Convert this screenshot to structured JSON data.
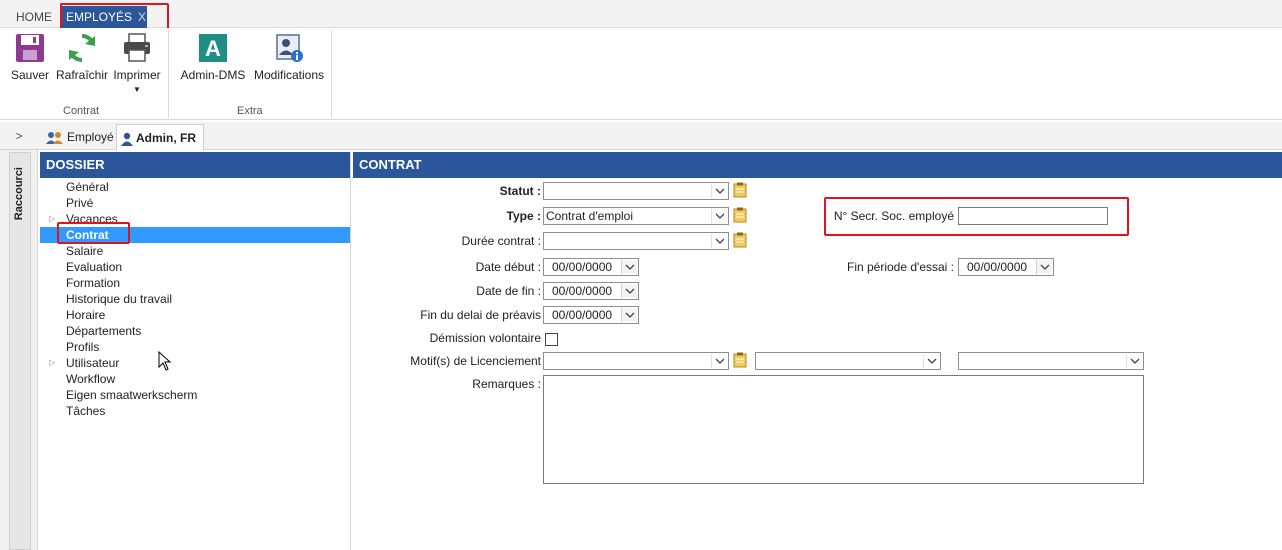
{
  "tabs": {
    "home": "HOME",
    "employes": "EMPLOYÉS",
    "close": "X"
  },
  "ribbon": {
    "save": "Sauver",
    "refresh": "Rafraîchir",
    "print": "Imprimer",
    "admin_dms": "Admin-DMS",
    "modifications": "Modifications",
    "group_contrat": "Contrat",
    "group_extra": "Extra"
  },
  "subtabs": {
    "collapse": ">",
    "employe": "Employé",
    "admin": "Admin, FR"
  },
  "rail": {
    "label": "Raccourci"
  },
  "dossier": {
    "title": "DOSSIER",
    "items": [
      {
        "label": "Général"
      },
      {
        "label": "Privé"
      },
      {
        "label": "Vacances"
      },
      {
        "label": "Contrat"
      },
      {
        "label": "Salaire"
      },
      {
        "label": "Evaluation"
      },
      {
        "label": "Formation"
      },
      {
        "label": "Historique du travail"
      },
      {
        "label": "Horaire"
      },
      {
        "label": "Départements"
      },
      {
        "label": "Profils"
      },
      {
        "label": "Utilisateur"
      },
      {
        "label": "Workflow"
      },
      {
        "label": "Eigen smaatwerkscherm"
      },
      {
        "label": "Tâches"
      }
    ]
  },
  "contrat": {
    "title": "CONTRAT",
    "statut_label": "Statut :",
    "statut_value": "",
    "type_label": "Type :",
    "type_value": "Contrat d'emploi",
    "duree_label": "Durée contrat :",
    "duree_value": "",
    "date_debut_label": "Date début :",
    "date_debut_value": "00/00/0000",
    "date_fin_label": "Date de fin :",
    "date_fin_value": "00/00/0000",
    "fin_preavis_label": "Fin du delai de préavis",
    "fin_preavis_value": "00/00/0000",
    "demission_label": "Démission volontaire",
    "motif_label": "Motif(s) de Licenciement",
    "remarques_label": "Remarques :",
    "nss_label": "N° Secr. Soc. employé",
    "nss_value": "",
    "essai_label": "Fin période d'essai :",
    "essai_value": "00/00/0000"
  }
}
